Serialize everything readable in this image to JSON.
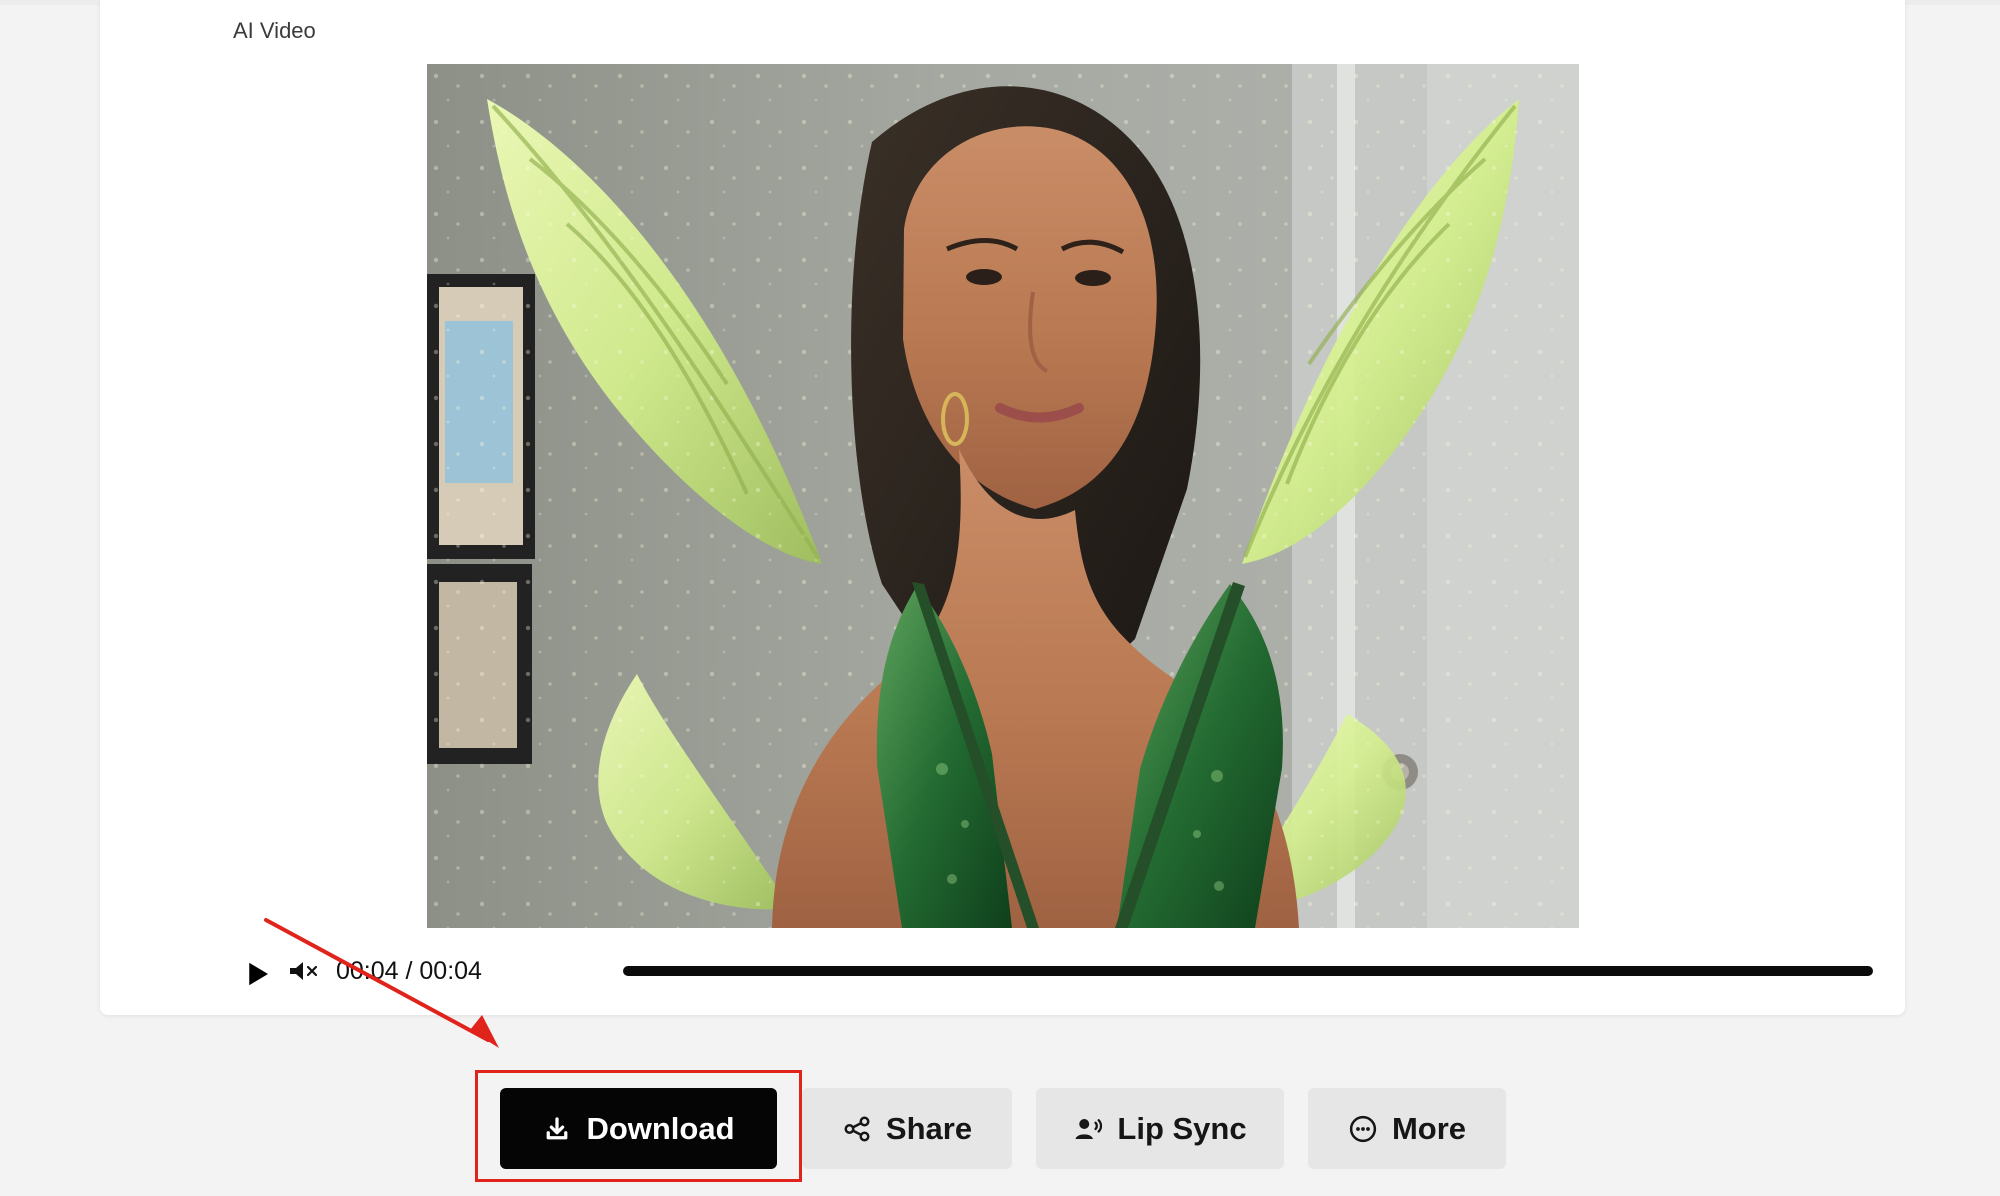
{
  "page": {
    "title": "AI Video"
  },
  "video": {
    "time": "00:04 / 00:04",
    "progress": 1.0
  },
  "actions": {
    "download": "Download",
    "share": "Share",
    "lip_sync": "Lip Sync",
    "more": "More"
  },
  "icons": {
    "play": "play-icon",
    "mute": "mute-icon",
    "download": "download-icon",
    "share": "share-icon",
    "lip_sync": "lip-sync-icon",
    "more": "more-icon"
  },
  "colors": {
    "primary_button": "#050505",
    "secondary_button": "#e6e6e6",
    "annotation": "#e0231b"
  }
}
